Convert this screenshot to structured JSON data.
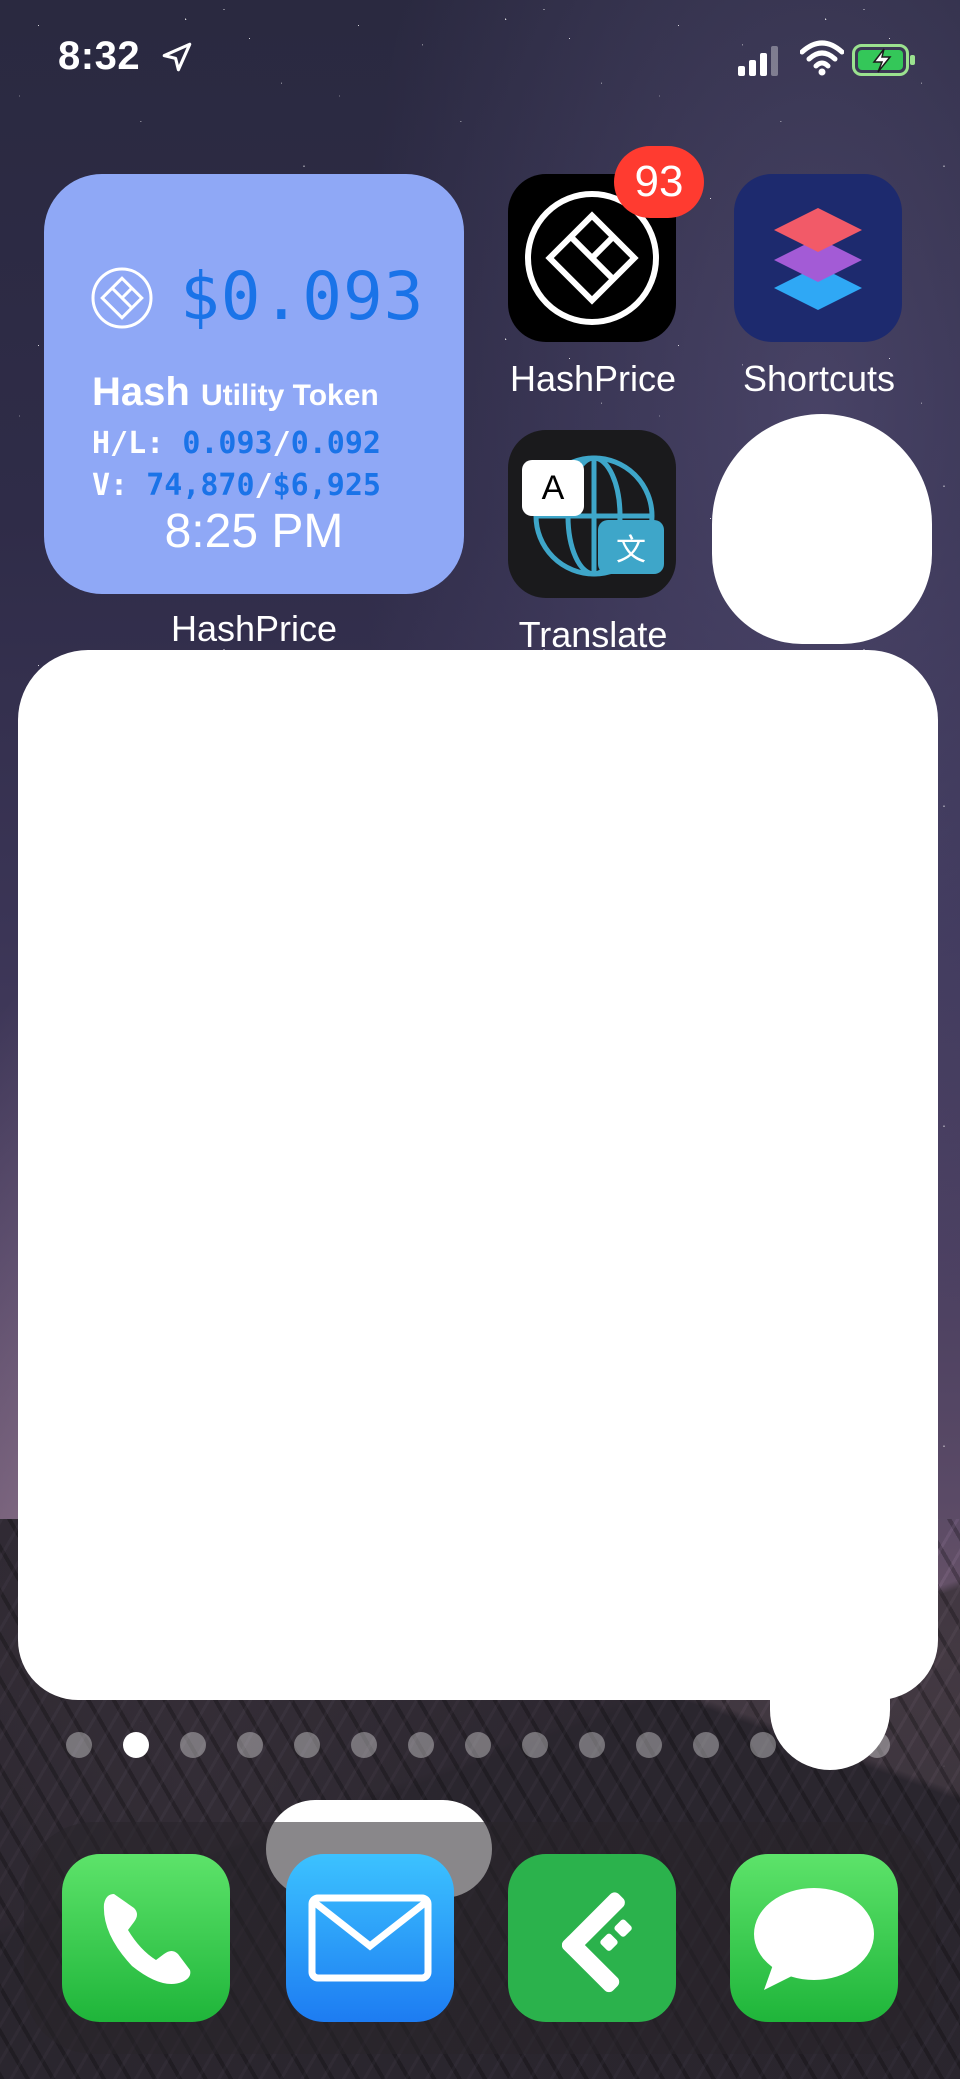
{
  "status_bar": {
    "time": "8:32"
  },
  "widget": {
    "price": "$0.093",
    "title_bold": "Hash",
    "title_sub": "Utility Token",
    "hl_label": "H/L:",
    "high": "0.093",
    "hl_sep": "/",
    "low": "0.092",
    "v_label": "V:",
    "volume": "74,870",
    "v_sep": "/",
    "volume_usd": "$6,925",
    "time": "8:25 PM",
    "label": "HashPrice"
  },
  "apps": {
    "hashprice": {
      "label": "HashPrice",
      "badge": "93"
    },
    "shortcuts": {
      "label": "Shortcuts"
    },
    "translate": {
      "label": "Translate",
      "glyph_a": "A",
      "glyph_b": "文"
    }
  },
  "page_dots": {
    "count": 15,
    "active_index": 1
  },
  "dock": [
    "Phone",
    "Mail",
    "Feedly",
    "Messages"
  ],
  "colors": {
    "widget_bg": "#8fa8f6",
    "widget_accent": "#1a73e8",
    "badge": "#ff3b30",
    "phone": "#30c94e",
    "mail": "#1e90ff",
    "feedly": "#2bb24c",
    "messages": "#30c94e"
  }
}
